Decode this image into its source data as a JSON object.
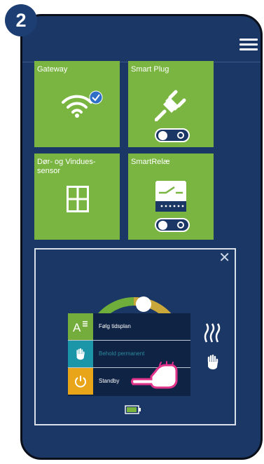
{
  "step": {
    "number": "2"
  },
  "colors": {
    "phone_bg": "#1a3766",
    "tile_green": "#7ab541",
    "badge": "#1c3e72",
    "mode_green": "#74ad3c",
    "mode_teal": "#1a96a8",
    "mode_orange": "#e9a519"
  },
  "icons": [
    "menu-icon",
    "wifi-icon",
    "checkmark-icon",
    "plug-icon",
    "window-icon",
    "relay-icon",
    "close-icon",
    "schedule-icon",
    "hand-icon",
    "power-icon",
    "heat-icon",
    "battery-icon",
    "pointing-hand-icon"
  ],
  "tiles": [
    {
      "label": "Gateway",
      "connected": true
    },
    {
      "label": "Smart Plug",
      "switch_on": false
    },
    {
      "label": "Dør- og Vindues-\nsensor"
    },
    {
      "label": "SmartRelæ",
      "switch_on": false
    }
  ],
  "thermostat": {
    "modes": [
      {
        "label": "Følg tidsplan"
      },
      {
        "label": "Behold permanent"
      },
      {
        "label": "Standby"
      }
    ],
    "battery_level": 0.8
  }
}
